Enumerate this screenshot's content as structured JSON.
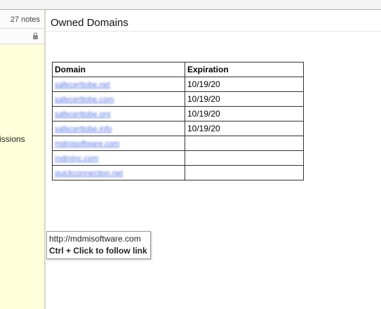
{
  "sidebar": {
    "note_count": "27 notes",
    "item_partial_text": "issions"
  },
  "page": {
    "title": "Owned Domains",
    "table": {
      "headers": [
        "Domain",
        "Expiration"
      ],
      "rows": [
        {
          "domain": "safecerttobe.net",
          "expiration": "10/19/20"
        },
        {
          "domain": "safecerttobe.com",
          "expiration": "10/19/20"
        },
        {
          "domain": "safecerttobe.org",
          "expiration": "10/19/20"
        },
        {
          "domain": "safecerttobe.info",
          "expiration": "10/19/20"
        },
        {
          "domain": "mdmisoftware.com",
          "expiration": ""
        },
        {
          "domain": "mdminc.com",
          "expiration": ""
        },
        {
          "domain": "quickconnection.net",
          "expiration": ""
        }
      ]
    }
  },
  "tooltip": {
    "url": "http://mdmisoftware.com",
    "hint": "Ctrl + Click to follow link"
  },
  "colors": {
    "sidebar_bg": "#ffffdb",
    "link": "#3b5bdb"
  }
}
